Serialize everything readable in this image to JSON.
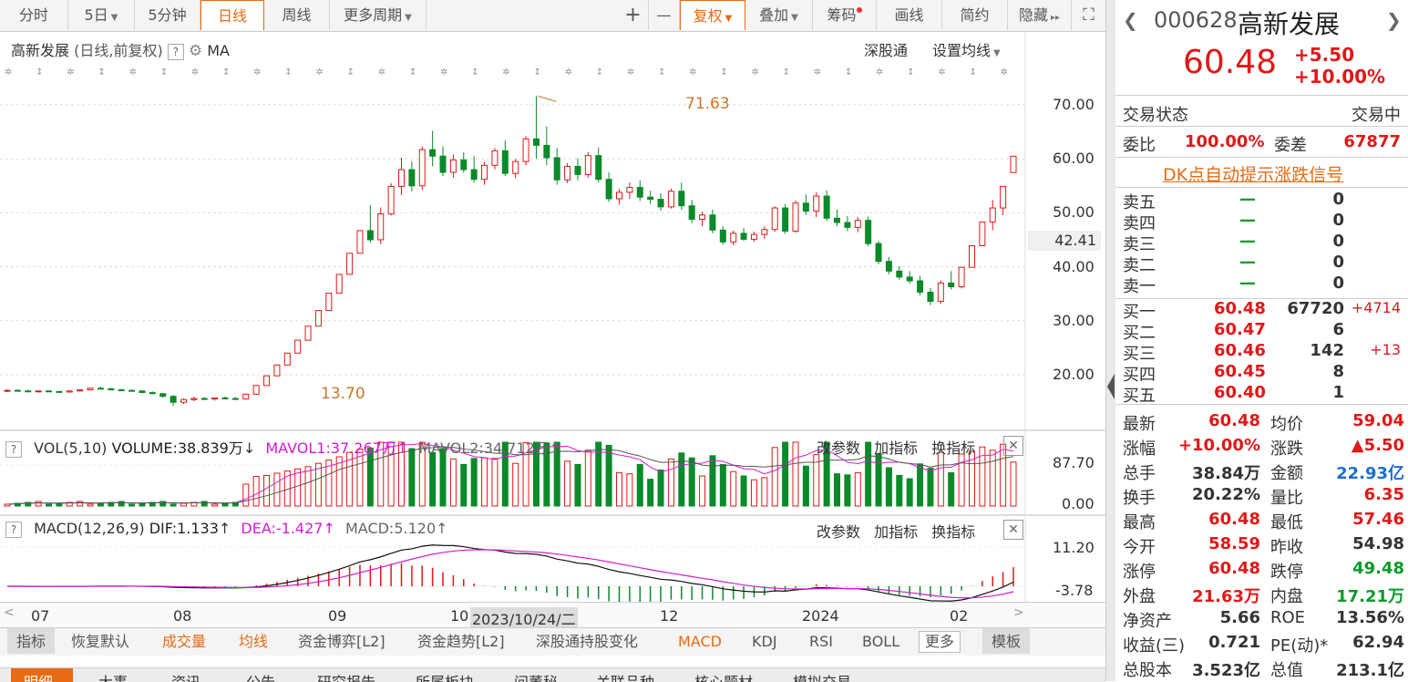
{
  "toolbar": {
    "periods": [
      "分时",
      "5日",
      "5分钟",
      "日线",
      "周线",
      "更多周期"
    ],
    "active": "日线",
    "actions": [
      "复权",
      "叠加",
      "筹码",
      "画线",
      "简约",
      "隐藏"
    ],
    "plus": "+",
    "minus": "—"
  },
  "legend": {
    "name": "高新发展",
    "mode": "(日线,前复权)",
    "ma": "MA",
    "shgt": "深股通",
    "set_ma": "设置均线"
  },
  "price_axis": [
    "70.00",
    "60.00",
    "50.00",
    "40.00",
    "30.00",
    "20.00"
  ],
  "current_price_tag": "42.41",
  "annotations": {
    "high": "71.63",
    "low": "13.70"
  },
  "vol": {
    "title": "VOL(5,10)",
    "volume": "VOLUME:38.839万",
    "mavol1": "MAVOL1:37.267万",
    "mavol2": "MAVOL2:34.712万",
    "axis": [
      "87.70",
      "0.00"
    ]
  },
  "macd": {
    "title": "MACD(12,26,9)",
    "dif": "DIF:1.133",
    "dea": "DEA:-1.427",
    "macd": "MACD:5.120",
    "axis": [
      "11.20",
      "-3.78"
    ]
  },
  "panel_links": [
    "改参数",
    "加指标",
    "换指标"
  ],
  "xaxis": [
    "07",
    "08",
    "09",
    "10",
    "12",
    "2024",
    "02"
  ],
  "xaxis_cursor": "2023/10/24/二",
  "bottom_tabs": [
    "指标",
    "恢复默认",
    "成交量",
    "均线",
    "资金博弈[L2]",
    "资金趋势[L2]",
    "深股通持股变化",
    "MACD",
    "KDJ",
    "RSI",
    "BOLL",
    "更多",
    "模板"
  ],
  "bottom_tabs2": [
    "明细",
    "大事",
    "资讯",
    "公告",
    "研究报告",
    "所属板块",
    "问董秘",
    "关联品种",
    "核心题材",
    "模拟交易"
  ],
  "quote": {
    "code": "000628",
    "name": "高新发展",
    "price": "60.48",
    "change": "+5.50",
    "pct": "+10.00%",
    "status_label": "交易状态",
    "status": "交易中",
    "wb_label": "委比",
    "wb": "100.00%",
    "wc_label": "委差",
    "wc": "67877",
    "dk": "DK点自动提示涨跌信号",
    "sells": [
      {
        "label": "卖五",
        "price": "—",
        "vol": "0"
      },
      {
        "label": "卖四",
        "price": "—",
        "vol": "0"
      },
      {
        "label": "卖三",
        "price": "—",
        "vol": "0"
      },
      {
        "label": "卖二",
        "price": "—",
        "vol": "0"
      },
      {
        "label": "卖一",
        "price": "—",
        "vol": "0"
      }
    ],
    "buys": [
      {
        "label": "买一",
        "price": "60.48",
        "vol": "67720",
        "chg": "+4714"
      },
      {
        "label": "买二",
        "price": "60.47",
        "vol": "6",
        "chg": ""
      },
      {
        "label": "买三",
        "price": "60.46",
        "vol": "142",
        "chg": "+13"
      },
      {
        "label": "买四",
        "price": "60.45",
        "vol": "8",
        "chg": ""
      },
      {
        "label": "买五",
        "price": "60.40",
        "vol": "1",
        "chg": ""
      }
    ],
    "stats": [
      {
        "l1": "最新",
        "v1": "60.48",
        "c1": "red",
        "l2": "均价",
        "v2": "59.04",
        "c2": "red"
      },
      {
        "l1": "涨幅",
        "v1": "+10.00%",
        "c1": "red",
        "l2": "涨跌",
        "v2": "▲5.50",
        "c2": "red"
      },
      {
        "l1": "总手",
        "v1": "38.84万",
        "c1": "",
        "l2": "金额",
        "v2": "22.93亿",
        "c2": "blu"
      },
      {
        "l1": "换手",
        "v1": "20.22%",
        "c1": "",
        "l2": "量比",
        "v2": "6.35",
        "c2": "red"
      },
      {
        "l1": "最高",
        "v1": "60.48",
        "c1": "red",
        "l2": "最低",
        "v2": "57.46",
        "c2": "red"
      },
      {
        "l1": "今开",
        "v1": "58.59",
        "c1": "red",
        "l2": "昨收",
        "v2": "54.98",
        "c2": ""
      },
      {
        "l1": "涨停",
        "v1": "60.48",
        "c1": "red",
        "l2": "跌停",
        "v2": "49.48",
        "c2": "grn"
      },
      {
        "l1": "外盘",
        "v1": "21.63万",
        "c1": "red",
        "l2": "内盘",
        "v2": "17.21万",
        "c2": "grn"
      },
      {
        "l1": "净资产",
        "v1": "5.66",
        "c1": "",
        "l2": "ROE",
        "v2": "13.56%",
        "c2": ""
      },
      {
        "l1": "收益(三)",
        "v1": "0.721",
        "c1": "",
        "l2": "PE(动)*",
        "v2": "62.94",
        "c2": ""
      },
      {
        "l1": "总股本",
        "v1": "3.523亿",
        "c1": "",
        "l2": "总值",
        "v2": "213.1亿",
        "c2": ""
      }
    ]
  },
  "chart_data": {
    "type": "candlestick",
    "series_ohlc": [
      [
        17,
        17.3,
        16.8,
        17.1
      ],
      [
        17.1,
        17.3,
        16.9,
        17
      ],
      [
        17,
        17.2,
        16.8,
        16.9
      ],
      [
        16.9,
        17.1,
        16.7,
        17
      ],
      [
        17,
        17.1,
        16.8,
        16.9
      ],
      [
        16.9,
        17,
        16.7,
        16.8
      ],
      [
        16.8,
        17.1,
        16.7,
        17
      ],
      [
        17,
        17.3,
        16.9,
        17.2
      ],
      [
        17.2,
        17.6,
        17.1,
        17.5
      ],
      [
        17.5,
        17.8,
        17.3,
        17.4
      ],
      [
        17.4,
        17.6,
        17.1,
        17.2
      ],
      [
        17.2,
        17.4,
        17,
        17.1
      ],
      [
        17.1,
        17.3,
        16.9,
        17
      ],
      [
        17,
        17.1,
        16.6,
        16.7
      ],
      [
        16.7,
        16.9,
        16.4,
        16.5
      ],
      [
        16.5,
        16.6,
        15.8,
        16
      ],
      [
        16,
        16.2,
        14.2,
        14.9
      ],
      [
        14.9,
        15.6,
        14.6,
        15.4
      ],
      [
        15.4,
        15.9,
        15.1,
        15.6
      ],
      [
        15.6,
        15.9,
        15.3,
        15.5
      ],
      [
        15.5,
        15.8,
        15.2,
        15.7
      ],
      [
        15.7,
        16,
        15.4,
        15.6
      ],
      [
        15.6,
        15.9,
        15.3,
        15.5
      ],
      [
        15.5,
        16.5,
        15.4,
        16.4
      ],
      [
        16.4,
        18.1,
        16.3,
        18
      ],
      [
        18,
        19.8,
        18,
        19.8
      ],
      [
        19.8,
        21.8,
        19.8,
        21.8
      ],
      [
        21.8,
        24,
        21.8,
        24
      ],
      [
        24,
        26.4,
        24,
        26.4
      ],
      [
        26.4,
        29,
        26.4,
        29
      ],
      [
        29,
        31.9,
        29,
        31.9
      ],
      [
        31.9,
        35.1,
        31.9,
        35.1
      ],
      [
        35.1,
        38.6,
        35.1,
        38.6
      ],
      [
        38.6,
        42.5,
        38.6,
        42.5
      ],
      [
        42.5,
        46.7,
        42.5,
        46.7
      ],
      [
        46.7,
        51.4,
        44.5,
        45
      ],
      [
        45,
        51,
        44.2,
        49.8
      ],
      [
        49.8,
        55.5,
        49.5,
        54.9
      ],
      [
        54.9,
        60.2,
        53.3,
        58
      ],
      [
        58,
        59.5,
        54,
        55
      ],
      [
        55,
        62.3,
        54.2,
        61.7
      ],
      [
        61.7,
        65.2,
        58.6,
        60.5
      ],
      [
        60.5,
        62.3,
        56.8,
        57.5
      ],
      [
        57.5,
        60.8,
        56.5,
        59.8
      ],
      [
        59.8,
        61.2,
        57.4,
        58
      ],
      [
        58,
        60.5,
        55.6,
        56.2
      ],
      [
        56.2,
        59.4,
        55.2,
        58.8
      ],
      [
        58.8,
        62,
        58,
        61.5
      ],
      [
        61.5,
        63.4,
        56.8,
        57.3
      ],
      [
        57.3,
        60,
        56.4,
        59.5
      ],
      [
        59.5,
        64.2,
        58.8,
        63.7
      ],
      [
        63.7,
        71.63,
        60,
        62.5
      ],
      [
        62.5,
        66,
        58.8,
        60.2
      ],
      [
        60.2,
        62,
        55.2,
        56.1
      ],
      [
        56.1,
        59.2,
        55.5,
        58.6
      ],
      [
        58.6,
        60.1,
        56,
        57.1
      ],
      [
        57.1,
        61.2,
        56.5,
        60.6
      ],
      [
        60.6,
        62.1,
        55.6,
        56.2
      ],
      [
        56.2,
        57.5,
        52,
        52.6
      ],
      [
        52.6,
        54.4,
        51.5,
        53.8
      ],
      [
        53.8,
        55.6,
        52.6,
        54.7
      ],
      [
        54.7,
        56,
        52.2,
        52.9
      ],
      [
        52.9,
        54.1,
        51.6,
        52.5
      ],
      [
        52.5,
        53.6,
        50.4,
        51.1
      ],
      [
        51.1,
        54.5,
        50.8,
        54
      ],
      [
        54,
        55.6,
        50.6,
        51.3
      ],
      [
        51.3,
        52.4,
        48.1,
        48.8
      ],
      [
        48.8,
        50.2,
        47.5,
        49.6
      ],
      [
        49.6,
        50.6,
        46.2,
        46.8
      ],
      [
        46.8,
        47.5,
        44.1,
        44.6
      ],
      [
        44.6,
        46.7,
        44,
        46.2
      ],
      [
        46.2,
        47.2,
        44.8,
        45.1
      ],
      [
        45.1,
        46.5,
        44.6,
        46
      ],
      [
        46,
        47.5,
        45.2,
        46.9
      ],
      [
        46.9,
        51.2,
        46.5,
        50.9
      ],
      [
        50.9,
        51.6,
        46.1,
        46.6
      ],
      [
        46.6,
        52.3,
        46.3,
        51.8
      ],
      [
        51.8,
        53.4,
        49.6,
        50.3
      ],
      [
        50.3,
        53.8,
        49.2,
        53.1
      ],
      [
        53.1,
        54.2,
        48.5,
        49
      ],
      [
        49,
        50.6,
        47.5,
        48.2
      ],
      [
        48.2,
        49.4,
        46.6,
        47.3
      ],
      [
        47.3,
        49.2,
        46.4,
        48.6
      ],
      [
        48.6,
        49.3,
        43.8,
        44.3
      ],
      [
        44.3,
        44.8,
        40.5,
        41
      ],
      [
        41,
        41.8,
        38.6,
        39.2
      ],
      [
        39.2,
        40.1,
        37.6,
        38.1
      ],
      [
        38.1,
        39.2,
        36.9,
        37.4
      ],
      [
        37.4,
        38.3,
        34.7,
        35.3
      ],
      [
        35.3,
        36.1,
        32.9,
        33.6
      ],
      [
        33.6,
        37.5,
        33.1,
        37
      ],
      [
        37,
        39.2,
        35.8,
        36.3
      ],
      [
        36.3,
        39.9,
        36,
        39.9
      ],
      [
        39.9,
        43.9,
        39.9,
        43.9
      ],
      [
        43.9,
        48.3,
        43.9,
        48.3
      ],
      [
        48.3,
        52.4,
        46.8,
        50.9
      ],
      [
        50.9,
        54.9,
        49.6,
        54.9
      ],
      [
        57.46,
        60.48,
        57.46,
        60.48
      ]
    ],
    "ylim": [
      13.7,
      71.63
    ],
    "high_label": "71.63",
    "low_label": "13.70"
  }
}
